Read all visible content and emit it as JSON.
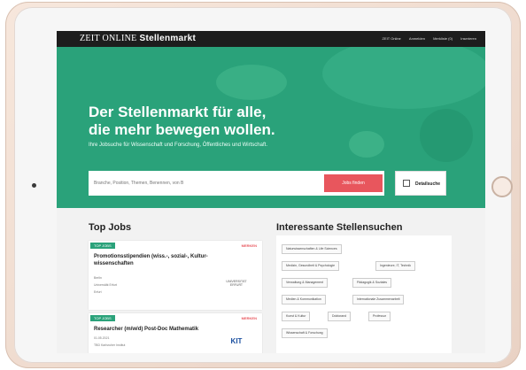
{
  "header": {
    "logo": "ZEIT",
    "logo_online": "ONLINE",
    "logo_sub": "Stellenmarkt",
    "links": [
      "ZEIT Online",
      "Anmelden",
      "Merkliste (0)",
      "Inserieren"
    ]
  },
  "hero": {
    "title_line1": "Der Stellenmarkt für alle,",
    "title_line2": "die mehr bewegen wollen.",
    "subtitle": "Ihre Jobsuche für Wissenschaft und Forschung, Öffentliches und Wirtschaft.",
    "search_placeholder": "Branche, Position, Themen, Benennen, von B",
    "search_button": "Jobs finden",
    "detail_button": "Detailsuche"
  },
  "top_jobs": {
    "title": "Top Jobs",
    "jobs": [
      {
        "tag": "TOP JOBS",
        "merken": "MERKEN",
        "title": "Promotionsstipendien (wiss.-, sozial-, Kultur-wissenschaften",
        "meta1": "Berlin",
        "meta2": "Universität Erfurt",
        "meta3": "Erfurt",
        "logo": "UNIVERSITÄT ERFURT"
      },
      {
        "tag": "TOP JOBS",
        "merken": "MERKEN",
        "title": "Researcher (m/w/d) Post-Doc Mathematik",
        "meta1": "01.05.2021",
        "meta2": "TBD Karlsruher Institut",
        "logo": "KIT"
      }
    ]
  },
  "interessant": {
    "title": "Interessante Stellensuchen",
    "chips": [
      "Naturwissenschaften & Life Sciences",
      "Medizin, Gesundheit & Psychologie",
      "Ingenieure, IT, Technik",
      "Verwaltung & Management",
      "Pädagogik & Soziales",
      "Medien & Kommunikation",
      "Internationale Zusammenarbeit",
      "Kunst & Kultur",
      "Doktorand",
      "Professur",
      "Wissenschaft & Forschung"
    ]
  }
}
